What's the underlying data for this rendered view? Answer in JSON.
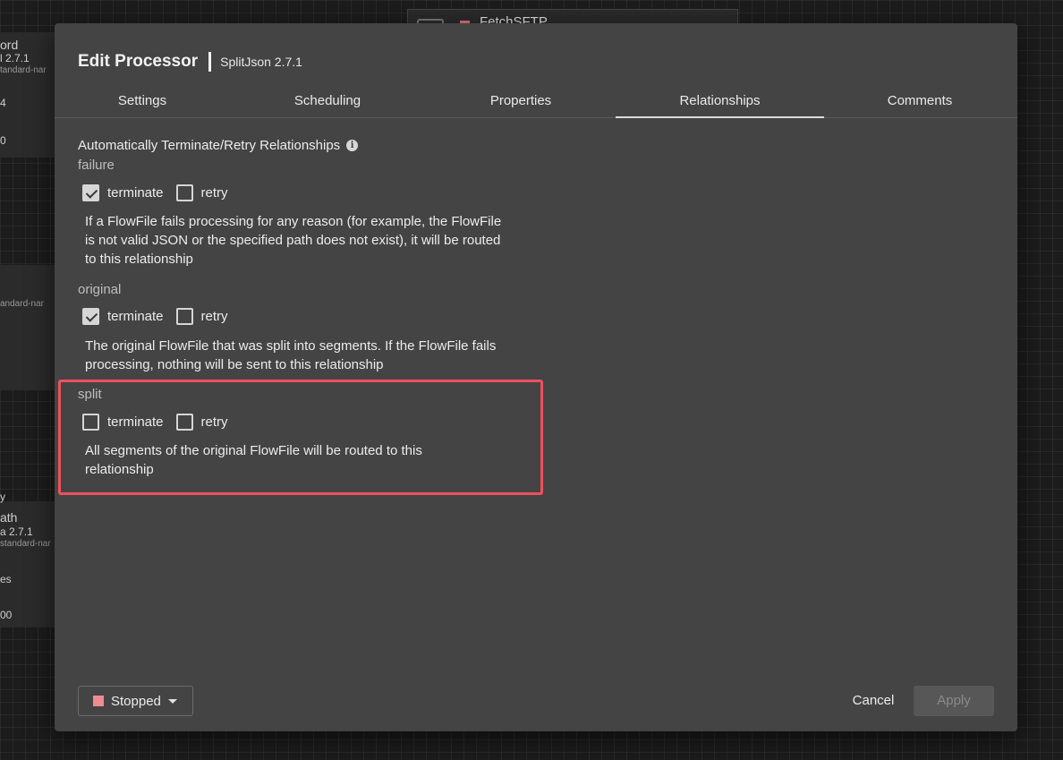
{
  "background": {
    "top_processor_name": "FetchSFTP",
    "proc1": {
      "name": "ord",
      "version": "l 2.7.1",
      "bundle": "tandard-nar",
      "row1": "4",
      "row2": "0"
    },
    "proc2": {
      "bundle": "andard-nar"
    },
    "proc3": {
      "pre": "y",
      "name": "ath",
      "version": "a 2.7.1",
      "bundle": "standard-nar",
      "row1": "es",
      "row2": "00"
    }
  },
  "dialog": {
    "title": "Edit Processor",
    "subtitle": "SplitJson 2.7.1"
  },
  "tabs": [
    "Settings",
    "Scheduling",
    "Properties",
    "Relationships",
    "Comments"
  ],
  "active_tab": "Relationships",
  "section_heading": "Automatically Terminate/Retry Relationships",
  "relationships": [
    {
      "name": "failure",
      "terminate_label": "terminate",
      "terminate_checked": true,
      "retry_label": "retry",
      "retry_checked": false,
      "description": "If a FlowFile fails processing for any reason (for example, the FlowFile is not valid JSON or the specified path does not exist), it will be routed to this relationship"
    },
    {
      "name": "original",
      "terminate_label": "terminate",
      "terminate_checked": true,
      "retry_label": "retry",
      "retry_checked": false,
      "description": "The original FlowFile that was split into segments. If the FlowFile fails processing, nothing will be sent to this relationship"
    },
    {
      "name": "split",
      "terminate_label": "terminate",
      "terminate_checked": false,
      "retry_label": "retry",
      "retry_checked": false,
      "description": "All segments of the original FlowFile will be routed to this relationship"
    }
  ],
  "footer": {
    "status_label": "Stopped",
    "status_color": "#f08b91",
    "cancel_label": "Cancel",
    "apply_label": "Apply"
  },
  "highlight_color": "#f0505f"
}
